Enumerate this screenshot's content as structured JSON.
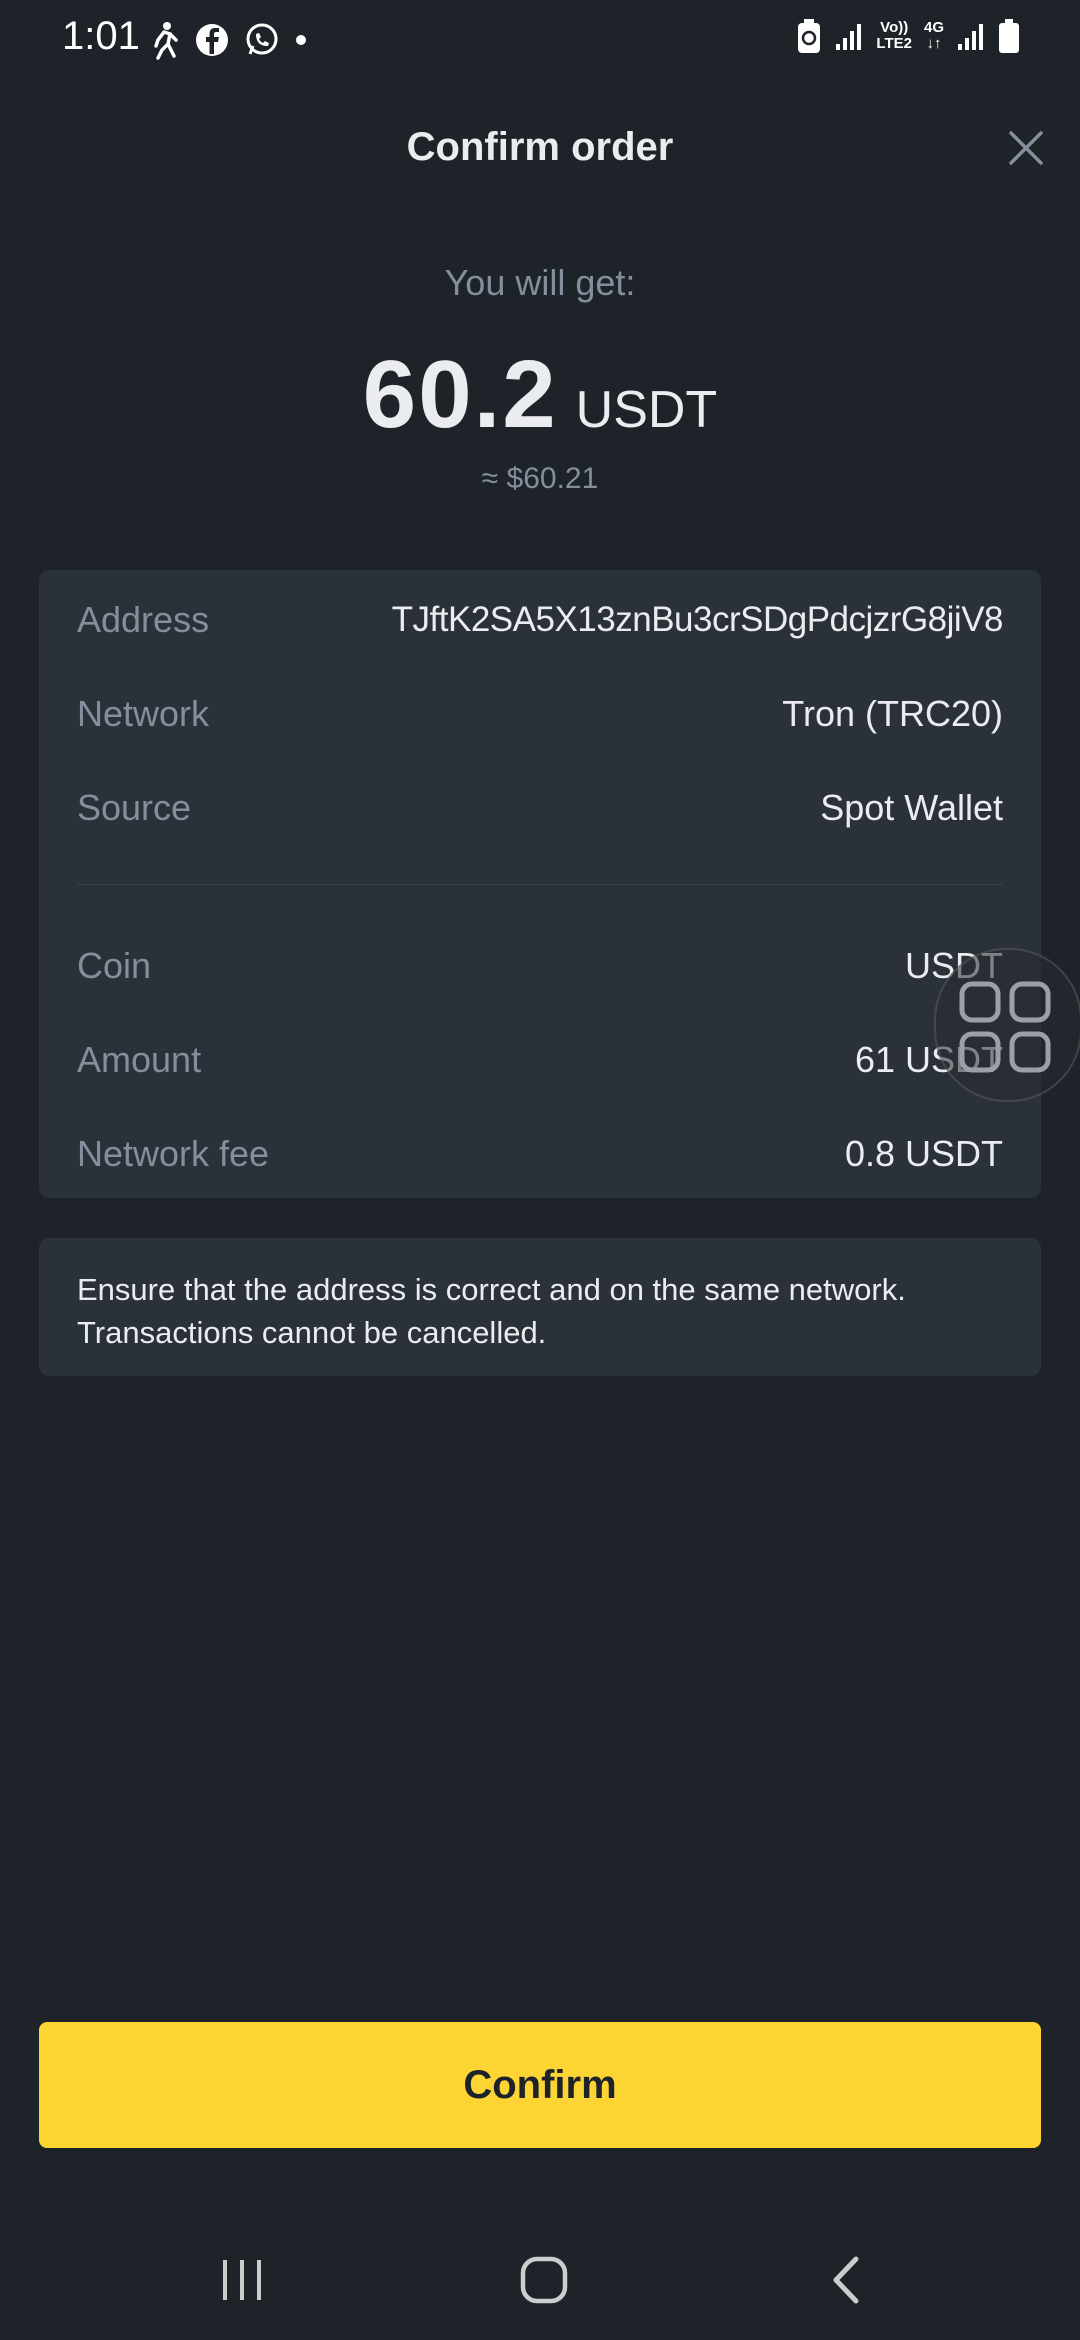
{
  "status_bar": {
    "time": "1:01",
    "net_label_top": "Vo))",
    "net_label_bottom": "LTE2",
    "net_4g": "4G"
  },
  "header": {
    "title": "Confirm order"
  },
  "summary": {
    "you_will_get_label": "You will get:",
    "amount": "60.2",
    "unit": "USDT",
    "usd_equivalent": "≈ $60.21"
  },
  "details": {
    "address_label": "Address",
    "address_value": "TJftK2SA5X13znBu3crSDgPdcjzrG8jiV8",
    "network_label": "Network",
    "network_value": "Tron (TRC20)",
    "source_label": "Source",
    "source_value": "Spot Wallet",
    "coin_label": "Coin",
    "coin_value": "USDT",
    "amount_label": "Amount",
    "amount_value": "61 USDT",
    "fee_label": "Network fee",
    "fee_value": "0.8 USDT"
  },
  "notice": {
    "line1": "Ensure that the address is correct and on the same network.",
    "line2": "Transactions cannot be cancelled."
  },
  "actions": {
    "confirm_label": "Confirm"
  },
  "colors": {
    "background": "#1e2329",
    "card": "#2b3139",
    "accent": "#fcd535",
    "muted_text": "#848e9c",
    "primary_text": "#eaecef"
  }
}
